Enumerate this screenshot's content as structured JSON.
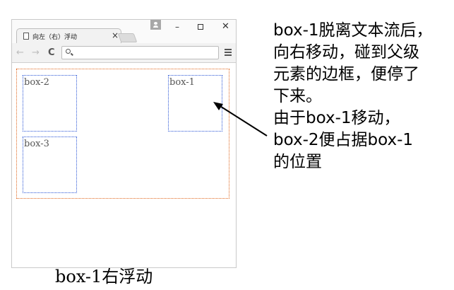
{
  "browser": {
    "tab_title": "向左（右）浮动",
    "tab_close": "×",
    "window_minimize": "–",
    "window_close": "✕",
    "nav_back": "←",
    "nav_forward": "→",
    "nav_reload": "C",
    "omnibox_value": ""
  },
  "page": {
    "box1_label": "box-1",
    "box2_label": "box-2",
    "box3_label": "box-3"
  },
  "caption": "box-1右浮动",
  "annotation": {
    "lines": [
      "box-1脱离文本流后，",
      "向右移动，碰到父级",
      "元素的边框，便停了",
      "下来。",
      "由于box-1移动，",
      "box-2便占据box-1",
      "的位置"
    ]
  },
  "colors": {
    "parent_border": "#e0671e",
    "child_border": "#2a55d6"
  }
}
